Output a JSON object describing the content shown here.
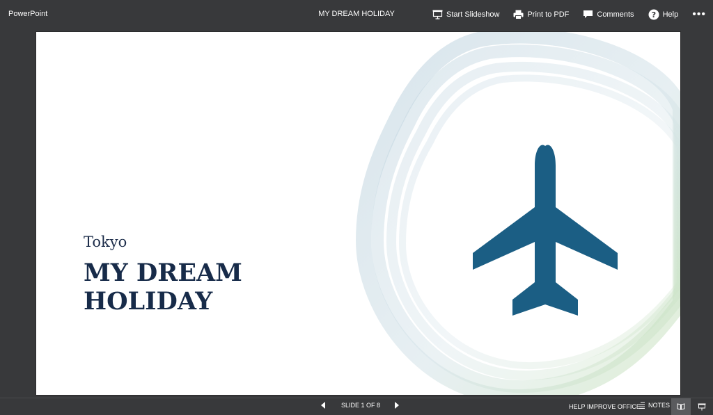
{
  "app": {
    "name": "PowerPoint"
  },
  "document": {
    "title": "MY DREAM HOLIDAY"
  },
  "toolbar": {
    "start_slideshow": "Start Slideshow",
    "print_to_pdf": "Print to PDF",
    "comments": "Comments",
    "help": "Help",
    "more": "•••"
  },
  "slide": {
    "subtitle": "Tokyo",
    "title_line1": "MY DREAM",
    "title_line2": "HOLIDAY",
    "icon": "airplane-icon",
    "colors": {
      "title": "#172b49",
      "airplane": "#1b5e84",
      "ring_blue": "#c9dbe6",
      "ring_green": "#cfe6c4"
    }
  },
  "statusbar": {
    "slide_counter": "SLIDE 1 OF 8",
    "help_improve": "HELP IMPROVE OFFICE",
    "notes": "NOTES"
  }
}
